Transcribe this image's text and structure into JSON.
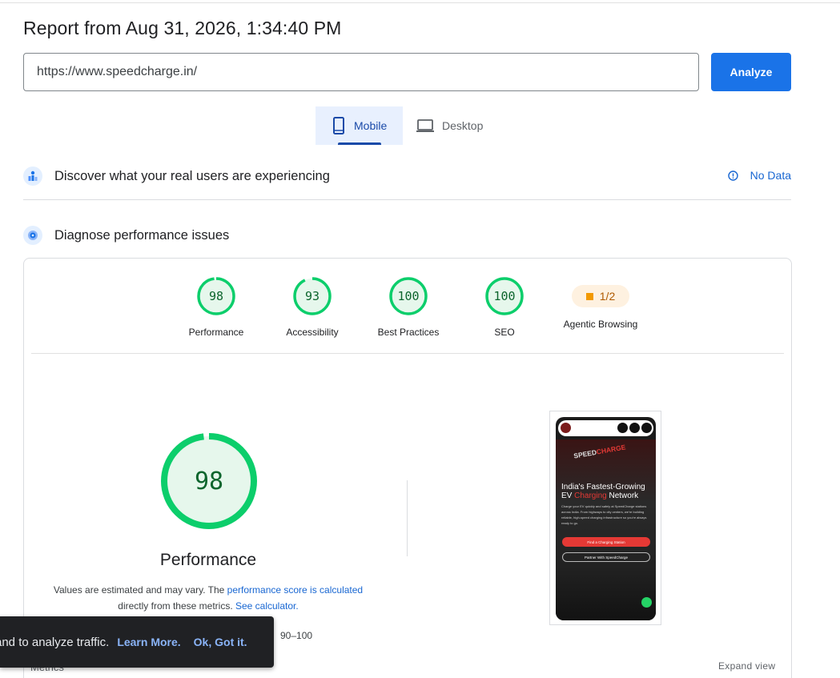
{
  "report": {
    "title": "Report from Aug 31, 2026, 1:34:40 PM",
    "url_value": "https://www.speedcharge.in/",
    "analyze_label": "Analyze"
  },
  "tabs": [
    {
      "label": "Mobile",
      "selected": true,
      "icon": "smartphone-icon"
    },
    {
      "label": "Desktop",
      "selected": false,
      "icon": "laptop-icon"
    }
  ],
  "discover": {
    "title": "Discover what your real users are experiencing",
    "status": "No Data",
    "icon": "crux-users-icon"
  },
  "diagnose": {
    "title": "Diagnose performance issues",
    "icon": "lighthouse-icon"
  },
  "categories": [
    {
      "label": "Performance",
      "score": "98",
      "fraction": 0.98
    },
    {
      "label": "Accessibility",
      "score": "93",
      "fraction": 0.93
    },
    {
      "label": "Best Practices",
      "score": "100",
      "fraction": 1.0
    },
    {
      "label": "SEO",
      "score": "100",
      "fraction": 1.0
    },
    {
      "label": "Agentic Browsing",
      "score": "1/2",
      "fraction": 0.5
    }
  ],
  "performance": {
    "score": "98",
    "fraction": 0.98,
    "label": "Performance",
    "note_prefix": "Values are estimated and may vary. The ",
    "note_link1": "performance score is calculated",
    "note_mid": "directly from these metrics. ",
    "note_link2": "See calculator.",
    "range_label": "90–100"
  },
  "screenshot": {
    "logo_prefix": "SPEED",
    "logo_suffix": "CHARGE",
    "headline_1": "India's Fastest-Growing",
    "headline_2a": "EV ",
    "headline_2b": "Charging",
    "headline_2c": " Network",
    "body": "Charge your EV quickly and safely at SpeedCharge stations across India. From highways to city centers, we're building reliable, high-speed charging infrastructure so you're always ready to go.",
    "btn_primary": "Find a Charging Station",
    "btn_secondary": "Partner With SpeedCharge"
  },
  "footer": {
    "expand_label": "Expand view",
    "metrics_label": "Metrics"
  },
  "toast": {
    "message": "and to analyze traffic.",
    "learn_more": "Learn More.",
    "ok": "Ok, Got it."
  },
  "colors": {
    "pass_green": "#0cce6b",
    "pass_fill": "#e6f7ec",
    "pass_text": "#0d652d",
    "average_orange": "#f29900",
    "link_blue": "#1967d2",
    "primary_blue": "#1a73e8"
  }
}
